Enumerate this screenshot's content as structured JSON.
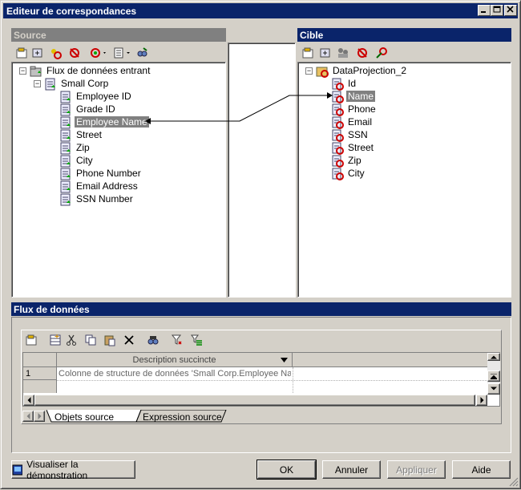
{
  "window": {
    "title": "Editeur de correspondances"
  },
  "source": {
    "header": "Source",
    "tree": {
      "root": "Flux de données entrant",
      "group": "Small Corp",
      "items": [
        "Employee ID",
        "Grade ID",
        "Employee Name",
        "Street",
        "Zip",
        "City",
        "Phone Number",
        "Email Address",
        "SSN Number"
      ],
      "selected": "Employee Name"
    }
  },
  "target": {
    "header": "Cible",
    "tree": {
      "root": "DataProjection_2",
      "items": [
        "Id",
        "Name",
        "Phone",
        "Email",
        "SSN",
        "Street",
        "Zip",
        "City"
      ],
      "selected": "Name"
    }
  },
  "dataflow": {
    "header": "Flux de données",
    "grid": {
      "column_header": "Description succincte",
      "rows": [
        {
          "num": "1",
          "description": "Colonne de structure de données 'Small Corp.Employee Nam"
        }
      ]
    },
    "tabs": [
      "Objets source",
      "Expression source"
    ]
  },
  "footer": {
    "demo_button": "Visualiser la démonstration",
    "ok": "OK",
    "cancel": "Annuler",
    "apply": "Appliquer",
    "help": "Aide"
  },
  "colors": {
    "title_active": "#0a246a",
    "title_inactive": "#808080",
    "face": "#d4d0c8"
  }
}
